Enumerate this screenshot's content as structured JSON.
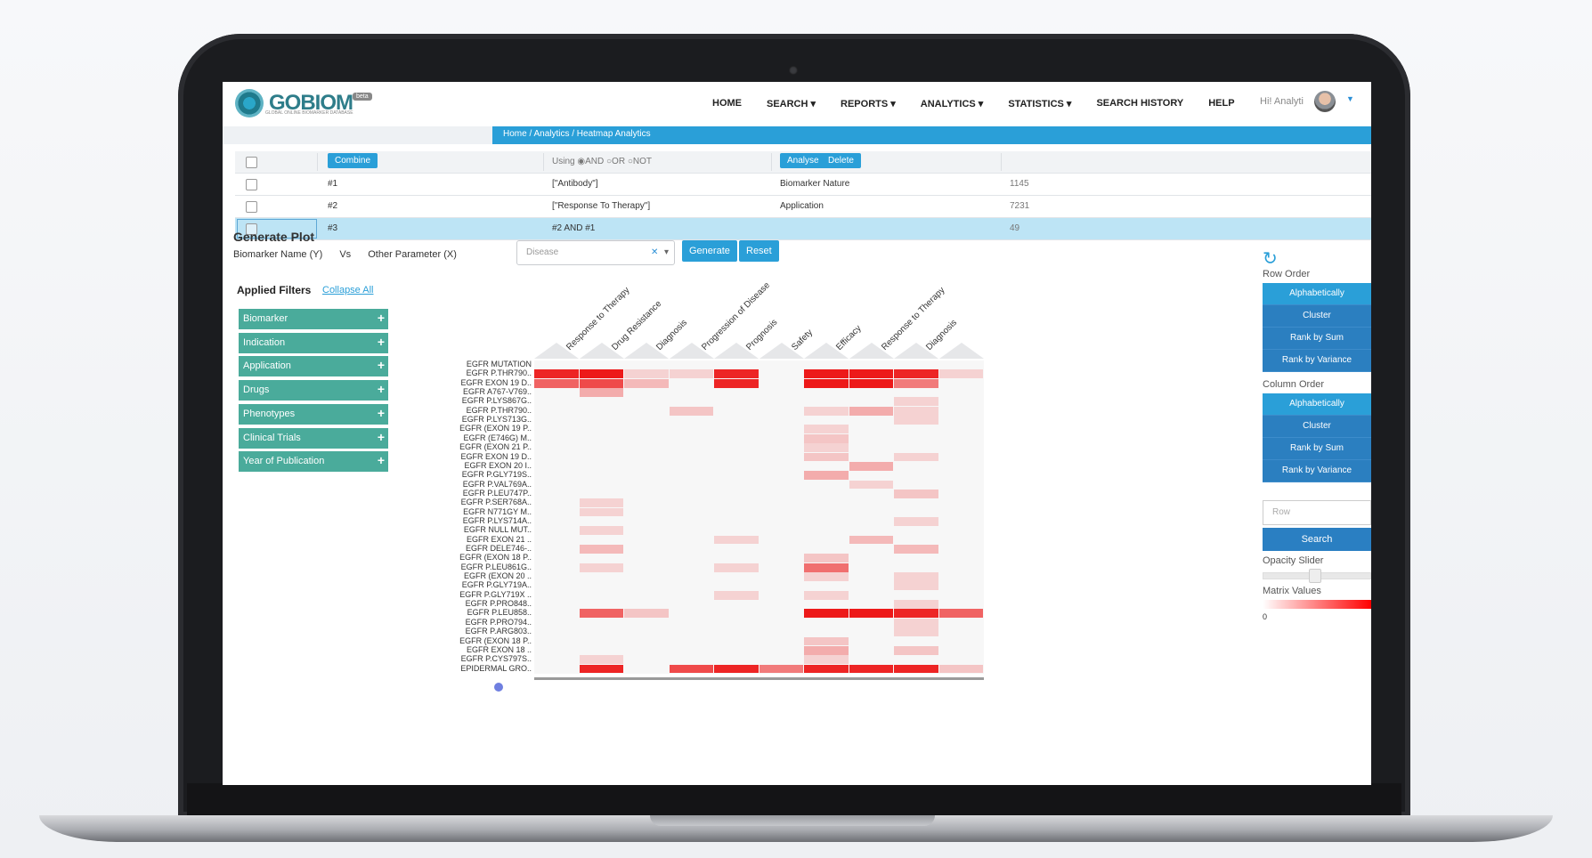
{
  "nav": {
    "logo": "GOBIOM",
    "logo_sub": "GLOBAL ONLINE BIOMARKER DATABASE",
    "badge": "beta",
    "items": [
      "HOME",
      "SEARCH",
      "REPORTS",
      "ANALYTICS",
      "STATISTICS",
      "SEARCH HISTORY",
      "HELP"
    ],
    "user": "Hi! Analyti"
  },
  "breadcrumb": "Home  /  Analytics  /  Heatmap Analytics",
  "query_table": {
    "combine": "Combine",
    "using": "Using",
    "ops": [
      "AND",
      "OR",
      "NOT"
    ],
    "analyse": "Analyse",
    "delete": "Delete",
    "rows": [
      {
        "id": "#1",
        "query": "[\"Antibody\"]",
        "category": "Biomarker Nature",
        "count": "1145"
      },
      {
        "id": "#2",
        "query": "[\"Response To Therapy\"]",
        "category": "Application",
        "count": "7231"
      },
      {
        "id": "#3",
        "query": "#2 AND #1",
        "category": "",
        "count": "49"
      }
    ]
  },
  "generate_plot": {
    "title": "Generate Plot",
    "y_label": "Biomarker Name (Y)",
    "vs": "Vs",
    "x_label": "Other Parameter (X)",
    "select_placeholder": "Disease",
    "generate": "Generate",
    "reset": "Reset"
  },
  "filters": {
    "title": "Applied Filters",
    "collapse": "Collapse All",
    "items": [
      "Biomarker",
      "Indication",
      "Application",
      "Drugs",
      "Phenotypes",
      "Clinical Trials",
      "Year of Publication"
    ]
  },
  "chart_data": {
    "type": "heatmap",
    "columns": [
      "Response to Therapy",
      "Drug Resistance",
      "Diagnosis",
      "Progression of Disease",
      "Prognosis",
      "Safety",
      "Efficacy",
      "Response to Therapy",
      "Diagnosis"
    ],
    "rows": [
      "EGFR MUTATION",
      "EGFR P.THR790..",
      "EGFR EXON 19 D..",
      "EGFR A767-V769..",
      "EGFR P.LYS867G..",
      "EGFR P.THR790..",
      "EGFR P.LYS713G..",
      "EGFR (EXON 19 P..",
      "EGFR (E746G) M..",
      "EGFR (EXON 21 P..",
      "EGFR EXON 19 D..",
      "EGFR EXON 20 I..",
      "EGFR P.GLY719S..",
      "EGFR P.VAL769A..",
      "EGFR P.LEU747P..",
      "EGFR P.SER768A..",
      "EGFR N771GY M..",
      "EGFR P.LYS714A..",
      "EGFR NULL MUT..",
      "EGFR EXON 21 ..",
      "EGFR DELE746-..",
      "EGFR (EXON 18 P..",
      "EGFR P.LEU861G..",
      "EGFR (EXON 20 ..",
      "EGFR P.GLY719A..",
      "EGFR P.GLY719X ..",
      "EGFR P.PRO848..",
      "EGFR P.LEU858..",
      "EGFR P.PRO794..",
      "EGFR P.ARG803..",
      "EGFR (EXON 18 P..",
      "EGFR EXON 18 ..",
      "EGFR P.CYS797S..",
      "EPIDERMAL GRO.."
    ],
    "values": [
      [
        0,
        0,
        0,
        0,
        0,
        0,
        0,
        0,
        0,
        0
      ],
      [
        0.85,
        0.9,
        0.15,
        0.15,
        0.85,
        0,
        0.9,
        0.9,
        0.85,
        0.15
      ],
      [
        0.6,
        0.7,
        0.25,
        0,
        0.85,
        0,
        0.9,
        0.9,
        0.5,
        0
      ],
      [
        0,
        0.3,
        0,
        0,
        0,
        0,
        0,
        0,
        0,
        0
      ],
      [
        0,
        0,
        0,
        0,
        0,
        0,
        0,
        0,
        0.15,
        0
      ],
      [
        0,
        0,
        0,
        0.2,
        0,
        0,
        0.15,
        0.3,
        0.15,
        0
      ],
      [
        0,
        0,
        0,
        0,
        0,
        0,
        0,
        0,
        0.15,
        0
      ],
      [
        0,
        0,
        0,
        0,
        0,
        0,
        0.15,
        0,
        0,
        0
      ],
      [
        0,
        0,
        0,
        0,
        0,
        0,
        0.2,
        0,
        0,
        0
      ],
      [
        0,
        0,
        0,
        0,
        0,
        0,
        0.15,
        0,
        0,
        0
      ],
      [
        0,
        0,
        0,
        0,
        0,
        0,
        0.2,
        0,
        0.15,
        0
      ],
      [
        0,
        0,
        0,
        0,
        0,
        0,
        0,
        0.3,
        0,
        0
      ],
      [
        0,
        0,
        0,
        0,
        0,
        0,
        0.3,
        0,
        0,
        0
      ],
      [
        0,
        0,
        0,
        0,
        0,
        0,
        0,
        0.15,
        0,
        0
      ],
      [
        0,
        0,
        0,
        0,
        0,
        0,
        0,
        0,
        0.2,
        0
      ],
      [
        0,
        0.15,
        0,
        0,
        0,
        0,
        0,
        0,
        0,
        0
      ],
      [
        0,
        0.15,
        0,
        0,
        0,
        0,
        0,
        0,
        0,
        0
      ],
      [
        0,
        0,
        0,
        0,
        0,
        0,
        0,
        0,
        0.15,
        0
      ],
      [
        0,
        0.15,
        0,
        0,
        0,
        0,
        0,
        0,
        0,
        0
      ],
      [
        0,
        0,
        0,
        0,
        0.15,
        0,
        0,
        0.25,
        0,
        0
      ],
      [
        0,
        0.25,
        0,
        0,
        0,
        0,
        0,
        0,
        0.25,
        0
      ],
      [
        0,
        0,
        0,
        0,
        0,
        0,
        0.2,
        0,
        0,
        0
      ],
      [
        0,
        0.15,
        0,
        0,
        0.15,
        0,
        0.55,
        0,
        0,
        0
      ],
      [
        0,
        0,
        0,
        0,
        0,
        0,
        0.15,
        0,
        0.15,
        0
      ],
      [
        0,
        0,
        0,
        0,
        0,
        0,
        0,
        0,
        0.15,
        0
      ],
      [
        0,
        0,
        0,
        0,
        0.15,
        0,
        0.15,
        0,
        0,
        0
      ],
      [
        0,
        0,
        0,
        0,
        0,
        0,
        0,
        0,
        0.15,
        0
      ],
      [
        0,
        0.6,
        0.2,
        0,
        0,
        0,
        0.9,
        0.9,
        0.85,
        0.6
      ],
      [
        0,
        0,
        0,
        0,
        0,
        0,
        0,
        0,
        0.15,
        0
      ],
      [
        0,
        0,
        0,
        0,
        0,
        0,
        0,
        0,
        0.15,
        0
      ],
      [
        0,
        0,
        0,
        0,
        0,
        0,
        0.2,
        0,
        0,
        0
      ],
      [
        0,
        0,
        0,
        0,
        0,
        0,
        0.3,
        0,
        0.2,
        0
      ],
      [
        0,
        0.15,
        0,
        0,
        0,
        0,
        0.15,
        0,
        0,
        0
      ],
      [
        0,
        0.85,
        0,
        0.7,
        0.85,
        0.5,
        0.85,
        0.85,
        0.85,
        0.2
      ]
    ]
  },
  "right_panel": {
    "row_order": "Row Order",
    "row_buttons": [
      "Alphabetically",
      "Cluster",
      "Rank by Sum",
      "Rank by Variance"
    ],
    "column_order": "Column Order",
    "col_buttons": [
      "Alphabetically",
      "Cluster",
      "Rank by Sum",
      "Rank by Variance"
    ],
    "row_placeholder": "Row",
    "search": "Search",
    "opacity": "Opacity Slider",
    "matrix": "Matrix Values",
    "min": "0"
  }
}
